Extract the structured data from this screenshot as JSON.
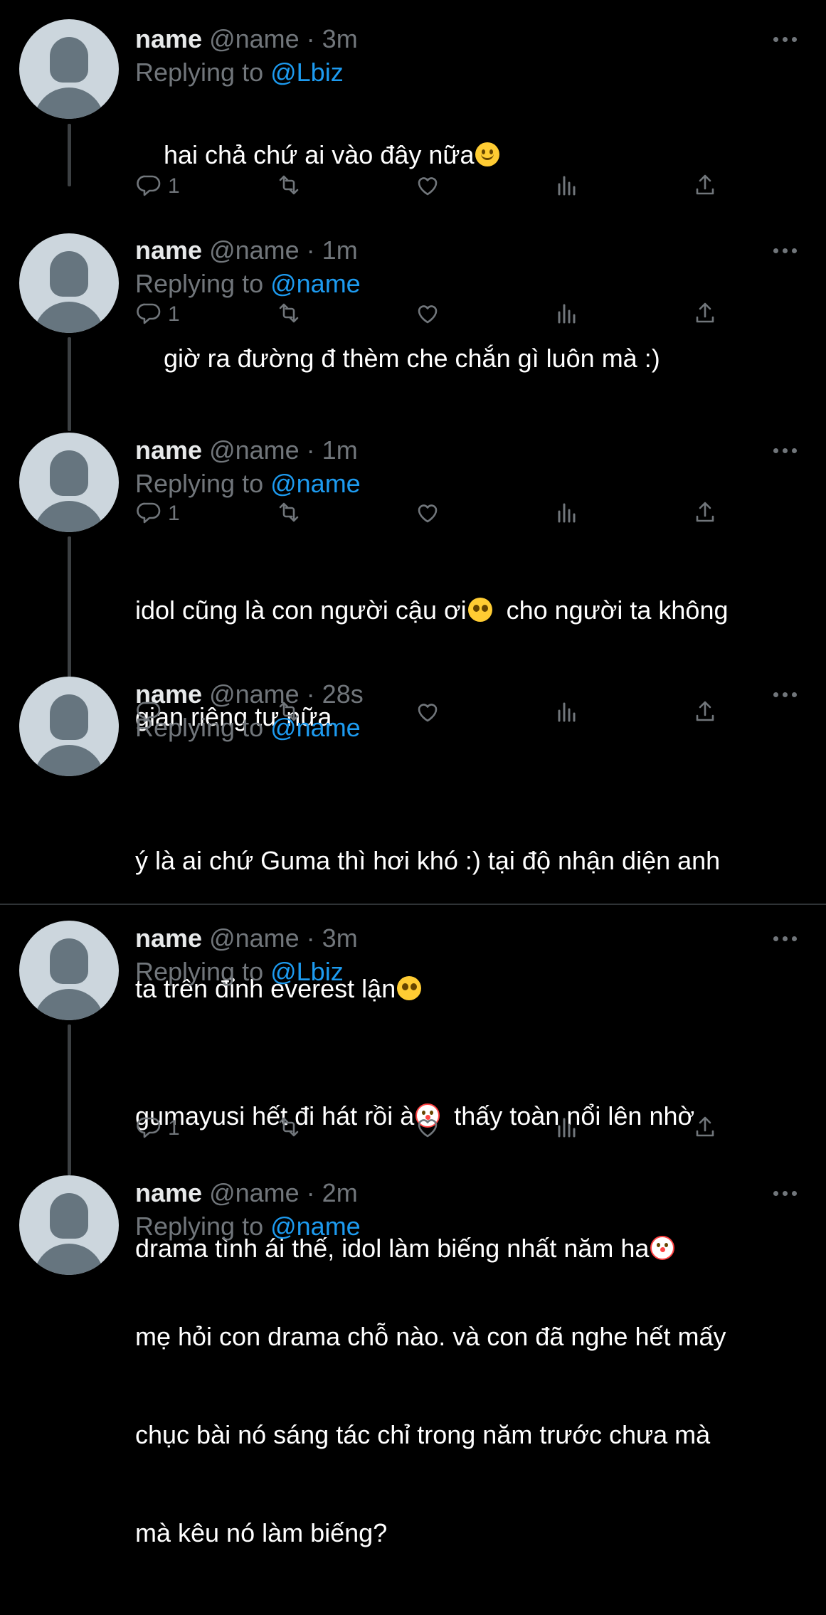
{
  "colors": {
    "background": "#000000",
    "text": "#ffffff",
    "muted": "#71767b",
    "link": "#1d9bf0",
    "avatar_bg": "#ccd6dd",
    "avatar_fg": "#66757f"
  },
  "icons": [
    "more-icon",
    "reply-icon",
    "retweet-icon",
    "like-icon",
    "analytics-icon",
    "share-icon"
  ],
  "tweets": [
    {
      "name": "name",
      "handle": "@name",
      "sep": " · ",
      "time": "3m",
      "replying_prefix": "Replying to ",
      "replying_to": "@Lbiz",
      "text": "hai chả chứ ai vào đây nữa",
      "emoji": "slightly-smiling-face",
      "reply_count": "1"
    },
    {
      "name": "name",
      "handle": "@name",
      "sep": " · ",
      "time": "1m",
      "replying_prefix": "Replying to ",
      "replying_to": "@name",
      "text": "giờ ra đường đ thèm che chắn gì luôn mà :)",
      "reply_count": "1"
    },
    {
      "name": "name",
      "handle": "@name",
      "sep": " · ",
      "time": "1m",
      "replying_prefix": "Replying to ",
      "replying_to": "@name",
      "text_line1": "idol cũng là con người cậu ơi",
      "text_line1b": "  cho người ta không",
      "text_line2": "gian riêng tư nữa",
      "emoji": "pleading-face",
      "reply_count": "1"
    },
    {
      "name": "name",
      "handle": "@name",
      "sep": " · ",
      "time": "28s",
      "replying_prefix": "Replying to ",
      "replying_to": "@name",
      "text_line1": "ý là ai chứ Guma thì hơi khó :) tại độ nhận diện anh",
      "text_line2": "ta trên đỉnh everest lận",
      "emoji": "pleading-face",
      "reply_count": ""
    },
    {
      "name": "name",
      "handle": "@name",
      "sep": " · ",
      "time": "3m",
      "replying_prefix": "Replying to ",
      "replying_to": "@Lbiz",
      "text_line1": "gumayusi hết đi hát rồi à",
      "text_line1b": "  thấy toàn nổi lên nhờ",
      "text_line2": "drama tình ái thế, idol làm biếng nhất năm ha",
      "emoji": "clown-face",
      "reply_count": "1"
    },
    {
      "name": "name",
      "handle": "@name",
      "sep": " · ",
      "time": "2m",
      "replying_prefix": "Replying to ",
      "replying_to": "@name",
      "text_line1": "mẹ hỏi con drama chỗ nào. và con đã nghe hết mấy",
      "text_line2": "chục bài nó sáng tác chỉ trong năm trước chưa mà",
      "text_line3": "mà kêu nó làm biếng?"
    }
  ]
}
